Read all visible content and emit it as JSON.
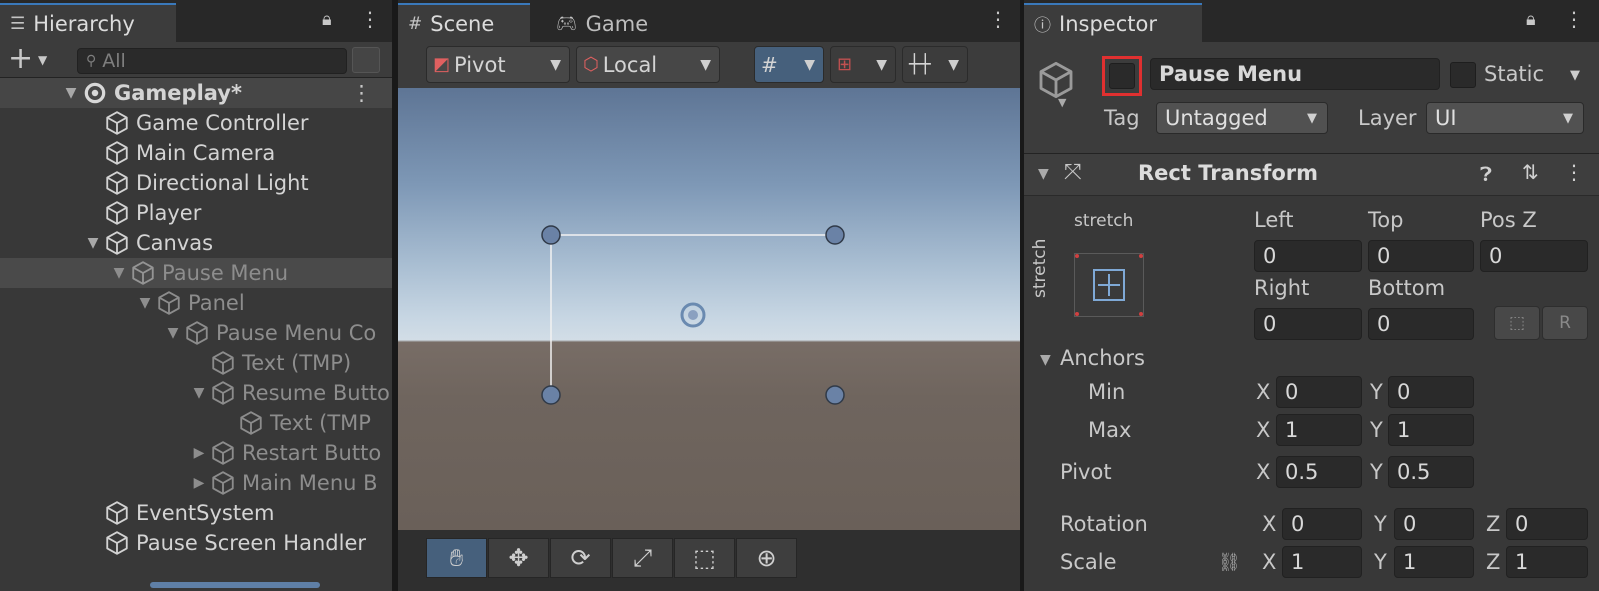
{
  "hierarchy": {
    "title": "Hierarchy",
    "search_placeholder": "All",
    "rows": [
      {
        "label": "Gameplay*"
      },
      {
        "label": "Game Controller"
      },
      {
        "label": "Main Camera"
      },
      {
        "label": "Directional Light"
      },
      {
        "label": "Player"
      },
      {
        "label": "Canvas"
      },
      {
        "label": "Pause Menu"
      },
      {
        "label": "Panel"
      },
      {
        "label": "Pause Menu Co"
      },
      {
        "label": "Text (TMP)"
      },
      {
        "label": "Resume Butto"
      },
      {
        "label": "Text (TMP"
      },
      {
        "label": "Restart Butto"
      },
      {
        "label": "Main Menu B"
      },
      {
        "label": "EventSystem"
      },
      {
        "label": "Pause Screen Handler"
      }
    ]
  },
  "scene": {
    "tabs": [
      {
        "label": "Scene"
      },
      {
        "label": "Game"
      }
    ],
    "pivot_label": "Pivot",
    "local_label": "Local"
  },
  "inspector": {
    "title": "Inspector",
    "object_name": "Pause Menu",
    "static_label": "Static",
    "tag_label": "Tag",
    "tag_value": "Untagged",
    "layer_label": "Layer",
    "layer_value": "UI",
    "component_title": "Rect Transform",
    "anchor_preset_top": "stretch",
    "anchor_preset_side": "stretch",
    "left_label": "Left",
    "left_value": "0",
    "top_label": "Top",
    "top_value": "0",
    "posz_label": "Pos Z",
    "posz_value": "0",
    "right_label": "Right",
    "right_value": "0",
    "bottom_label": "Bottom",
    "bottom_value": "0",
    "raw_label": "R",
    "anchors_label": "Anchors",
    "min_label": "Min",
    "min_x": "0",
    "min_y": "0",
    "max_label": "Max",
    "max_x": "1",
    "max_y": "1",
    "pivot_label": "Pivot",
    "pivot_x": "0.5",
    "pivot_y": "0.5",
    "rotation_label": "Rotation",
    "rot_x": "0",
    "rot_y": "0",
    "rot_z": "0",
    "scale_label": "Scale",
    "scale_x": "1",
    "scale_y": "1",
    "scale_z": "1",
    "axis_x": "X",
    "axis_y": "Y",
    "axis_z": "Z"
  },
  "colors": {
    "selection": "#3a79bb",
    "highlight_box": "#e03030"
  }
}
